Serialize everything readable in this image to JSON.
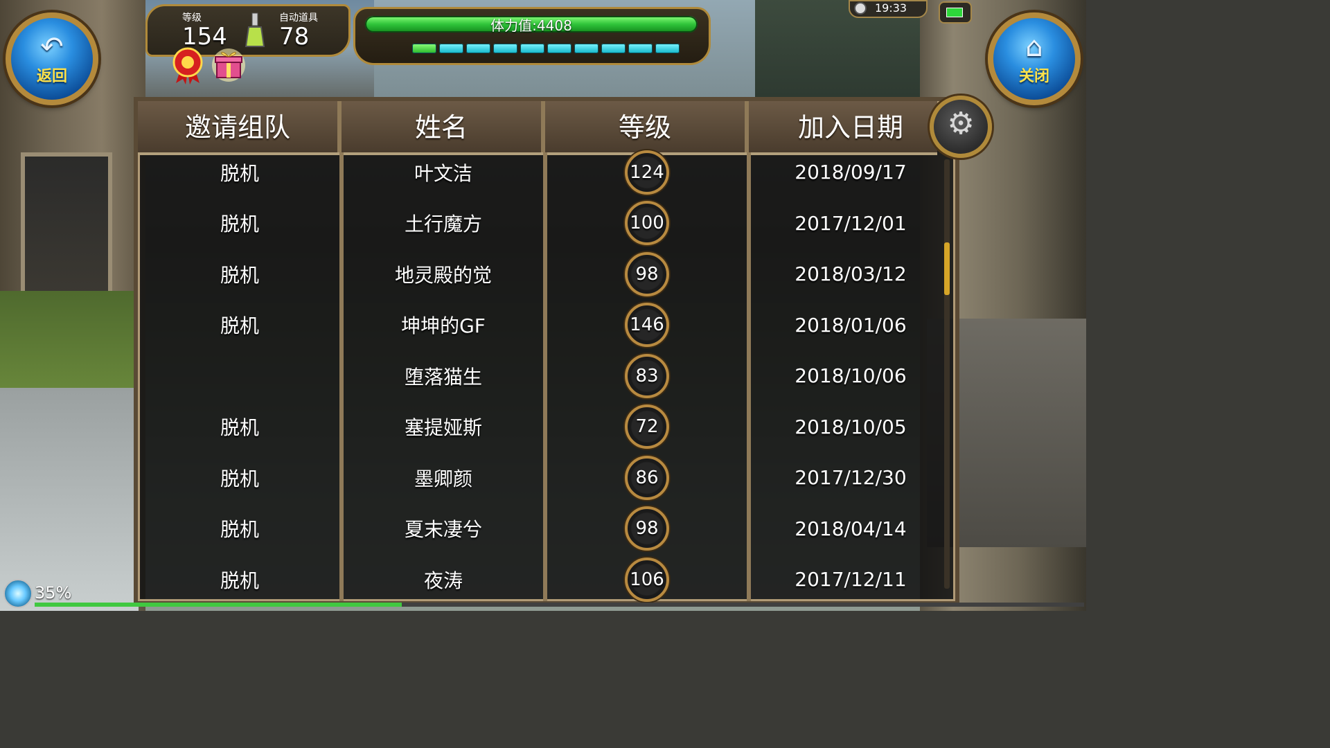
{
  "hud": {
    "back_label": "返回",
    "close_label": "关闭",
    "level_caption": "等级",
    "level_value": "154",
    "auto_item_caption": "自动道具",
    "auto_item_value": "78",
    "stamina_text": "体力值:4408",
    "clock": "19:33",
    "exp_percent": "35%",
    "exp_fraction": 0.35
  },
  "table": {
    "headers": [
      "邀请组队",
      "姓名",
      "等级",
      "加入日期"
    ],
    "rows": [
      {
        "status": "脱机",
        "name": "叶文洁",
        "level": "124",
        "date": "2018/09/17"
      },
      {
        "status": "脱机",
        "name": "土行魔方",
        "level": "100",
        "date": "2017/12/01"
      },
      {
        "status": "脱机",
        "name": "地灵殿的觉",
        "level": "98",
        "date": "2018/03/12"
      },
      {
        "status": "脱机",
        "name": "坤坤的GF",
        "level": "146",
        "date": "2018/01/06"
      },
      {
        "status": "",
        "name": "堕落猫生",
        "level": "83",
        "date": "2018/10/06"
      },
      {
        "status": "脱机",
        "name": "塞提娅斯",
        "level": "72",
        "date": "2018/10/05"
      },
      {
        "status": "脱机",
        "name": "墨卿颜",
        "level": "86",
        "date": "2017/12/30"
      },
      {
        "status": "脱机",
        "name": "夏末凄兮",
        "level": "98",
        "date": "2018/04/14"
      },
      {
        "status": "脱机",
        "name": "夜涛",
        "level": "106",
        "date": "2017/12/11"
      }
    ]
  },
  "icons": {
    "back": "back-arrow-icon",
    "close": "home-icon",
    "settings": "gear-icon",
    "potion": "potion-icon",
    "medal": "medal-icon",
    "gift": "gift-icon"
  },
  "colors": {
    "accent_gold": "#b08a3a",
    "stamina_green": "#2fc43a",
    "segment_cyan": "#12b6c9",
    "button_blue": "#2a8ee0",
    "button_label_yellow": "#ffe24a"
  }
}
